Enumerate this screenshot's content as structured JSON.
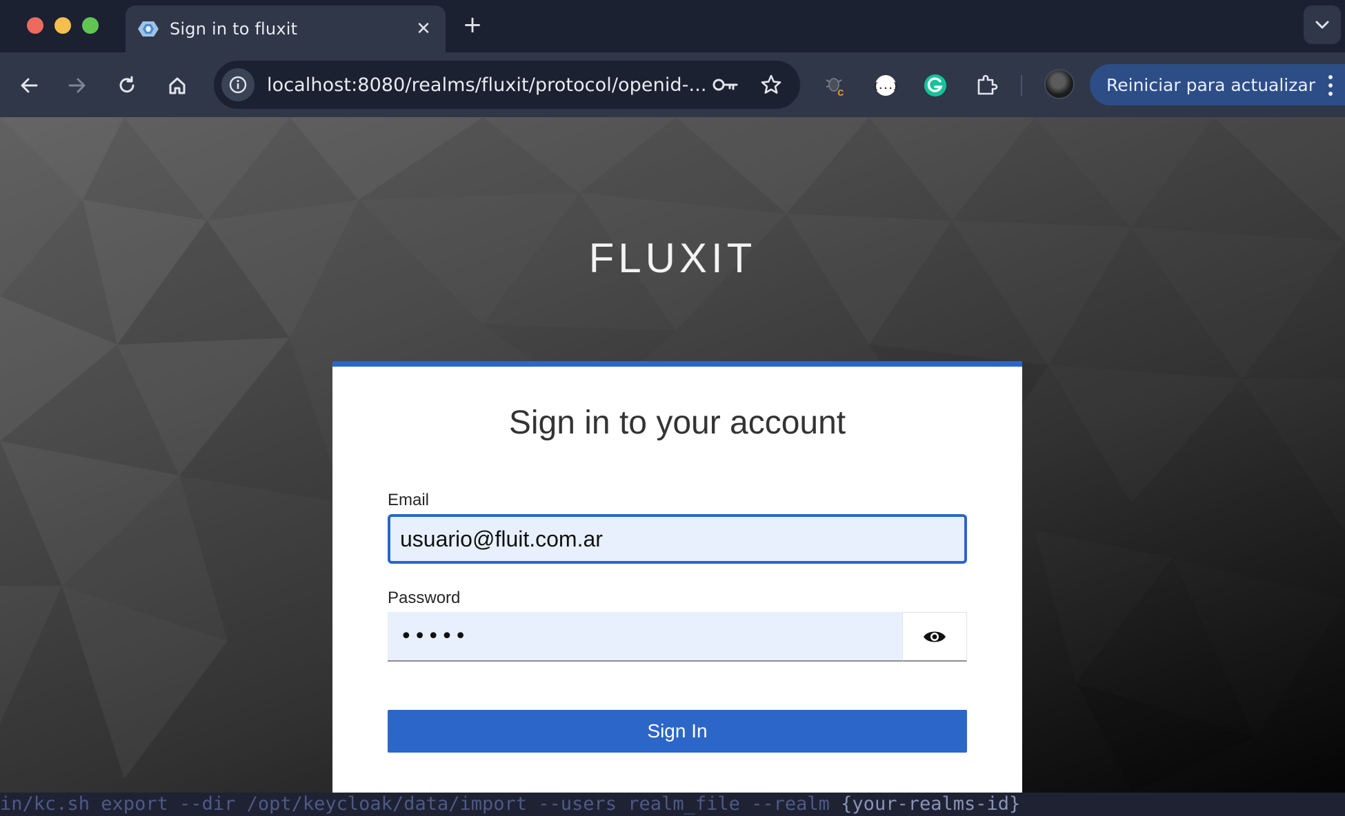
{
  "browser": {
    "tab_title": "Sign in to fluxit",
    "tab_close": "✕",
    "new_tab": "+",
    "url": "localhost:8080/realms/fluxit/protocol/openid-...",
    "update_label": "Reiniciar para actualizar",
    "icons": [
      "back-arrow-icon",
      "forward-arrow-icon",
      "reload-icon",
      "home-icon",
      "site-info-icon",
      "password-key-icon",
      "bookmark-star-icon",
      "bug-extension-icon",
      "json-extension-icon",
      "grammarly-extension-icon",
      "extensions-puzzle-icon",
      "profile-avatar",
      "more-menu-icon",
      "tab-search-chevron-icon"
    ]
  },
  "login": {
    "brand": "FLUXIT",
    "heading": "Sign in to your account",
    "email_label": "Email",
    "email_value": "usuario@fluit.com.ar",
    "password_label": "Password",
    "password_value": "•••••",
    "submit_label": "Sign In"
  },
  "terminal": {
    "prefix": "in/kc.sh export --dir /opt/keycloak/data/import --users realm_file --realm",
    "arg": "{your-realms-id}"
  },
  "colors": {
    "accent": "#2b66c8",
    "input_fill": "#e8f0fe",
    "chrome_dark": "#1b2131",
    "chrome_toolbar": "#2f3749",
    "update_button": "#2d4d86"
  }
}
